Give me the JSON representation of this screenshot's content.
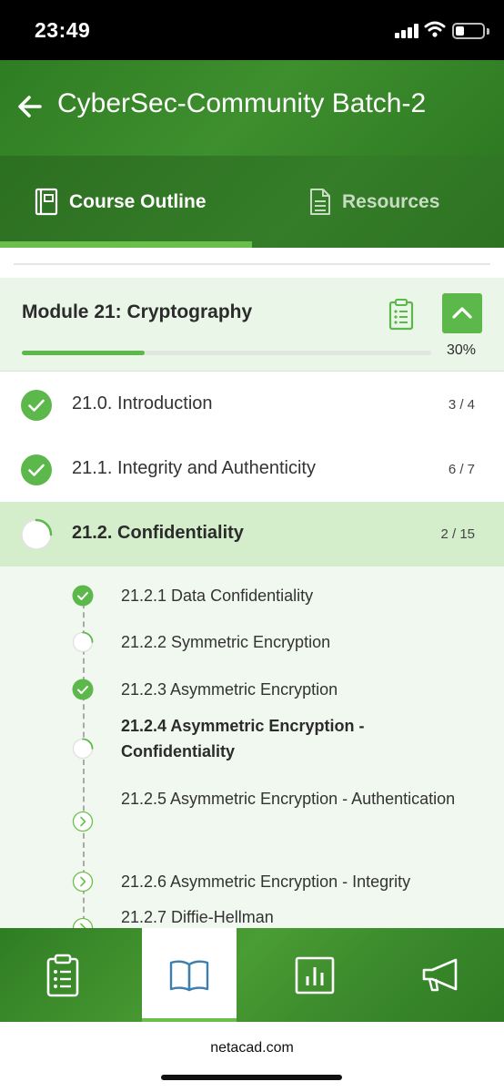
{
  "status_bar": {
    "time": "23:49"
  },
  "header": {
    "title": "CyberSec-Community Batch-2"
  },
  "tabs": [
    {
      "label": "Course Outline",
      "icon": "book-icon",
      "active": true
    },
    {
      "label": "Resources",
      "icon": "document-icon",
      "active": false
    }
  ],
  "module": {
    "title": "Module 21: Cryptography",
    "progress_percent": 30,
    "progress_label": "30%"
  },
  "lessons": [
    {
      "label": "21.0. Introduction",
      "count": "3 / 4",
      "status": "complete"
    },
    {
      "label": "21.1. Integrity and Authenticity",
      "count": "6 / 7",
      "status": "complete"
    },
    {
      "label": "21.2. Confidentiality",
      "count": "2 / 15",
      "status": "in-progress"
    }
  ],
  "subtopics": [
    {
      "label": "21.2.1 Data Confidentiality",
      "status": "complete"
    },
    {
      "label": "21.2.2 Symmetric Encryption",
      "status": "in-progress"
    },
    {
      "label": "21.2.3 Asymmetric Encryption",
      "status": "complete"
    },
    {
      "label": "21.2.4 Asymmetric Encryption - Confidentiality",
      "status": "current"
    },
    {
      "label": "21.2.5 Asymmetric Encryption - Authentication",
      "status": "not-started"
    },
    {
      "label": "21.2.6 Asymmetric Encryption - Integrity",
      "status": "not-started"
    },
    {
      "label": "21.2.7 Diffie-Hellman",
      "status": "not-started"
    }
  ],
  "bottom_nav": [
    {
      "icon": "clipboard-icon",
      "active": false
    },
    {
      "icon": "open-book-icon",
      "active": true
    },
    {
      "icon": "bar-chart-icon",
      "active": false
    },
    {
      "icon": "megaphone-icon",
      "active": false
    }
  ],
  "browser": {
    "url": "netacad.com"
  },
  "colors": {
    "brand_green": "#3e8f2e",
    "accent_green": "#5cb84a",
    "active_row": "#d4eecc"
  }
}
